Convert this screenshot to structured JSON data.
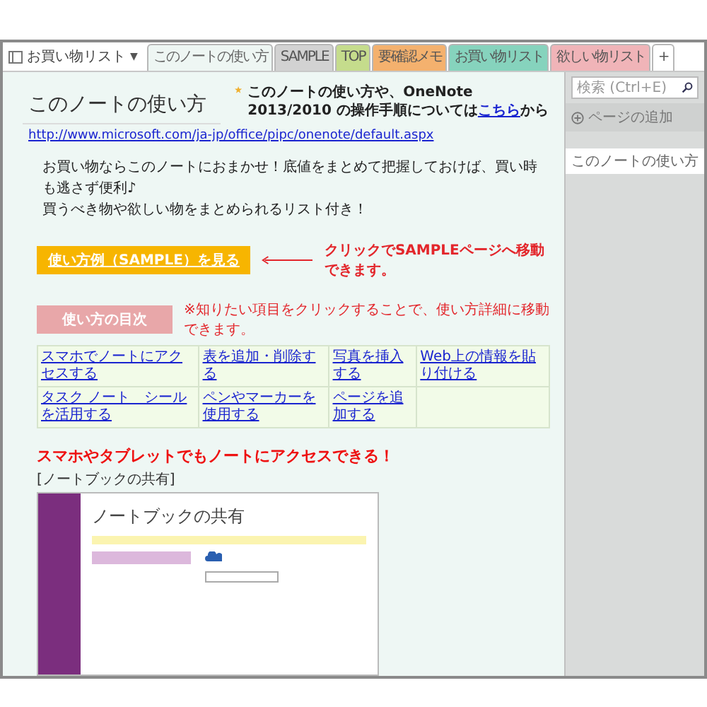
{
  "notebook": {
    "name": "お買い物リスト",
    "caret": "▼"
  },
  "tabs": [
    {
      "label": "このノートの使い方",
      "selected": true,
      "color": "#e8ece9"
    },
    {
      "label": "SAMPLE",
      "selected": false,
      "color": "#d2d2d2"
    },
    {
      "label": "TOP",
      "selected": false,
      "color": "#c5dc8c"
    },
    {
      "label": "要確認メモ",
      "selected": false,
      "color": "#f4b16e"
    },
    {
      "label": "お買い物リスト",
      "selected": false,
      "color": "#86d3bd"
    },
    {
      "label": "欲しい物リスト",
      "selected": false,
      "color": "#f0b4b8"
    },
    {
      "label": "+",
      "selected": false,
      "color": "#ffffff"
    }
  ],
  "search": {
    "placeholder": "検索 (Ctrl+E)"
  },
  "sidebar": {
    "add_page": "ページの追加",
    "pages": [
      {
        "label": "このノートの使い方",
        "selected": true
      }
    ]
  },
  "page": {
    "title": "このノートの使い方",
    "intro": {
      "before": "このノートの使い方や、OneNote 2013/2010 の操作手順については",
      "link": "こちら",
      "after": "から"
    },
    "url": "http://www.microsoft.com/ja-jp/office/pipc/onenote/default.aspx",
    "paragraph": [
      "お買い物ならこのノートにおまかせ！底値をまとめて把握しておけば、買い時も逃さず便利♪",
      "買うべき物や欲しい物をまとめられるリスト付き！"
    ],
    "sample_button": "使い方例（SAMPLE）を見る",
    "sample_note": "クリックでSAMPLEページへ移動できます。",
    "toc_label": "使い方の目次",
    "toc_note": "※知りたい項目をクリックすることで、使い方詳細に移動できます。",
    "toc": [
      [
        "スマホでノートにアクセスする",
        "表を追加・削除する",
        "写真を挿入する",
        "Web上の情報を貼り付ける"
      ],
      [
        "タスク ノート　シールを活用する",
        "ペンやマーカーを使用する",
        "ページを追加する"
      ]
    ],
    "section_heading": "スマホやタブレットでもノートにアクセスできる！",
    "section_caption": "[ノートブックの共有]",
    "screenshot": {
      "heading": "ノートブックの共有"
    }
  }
}
